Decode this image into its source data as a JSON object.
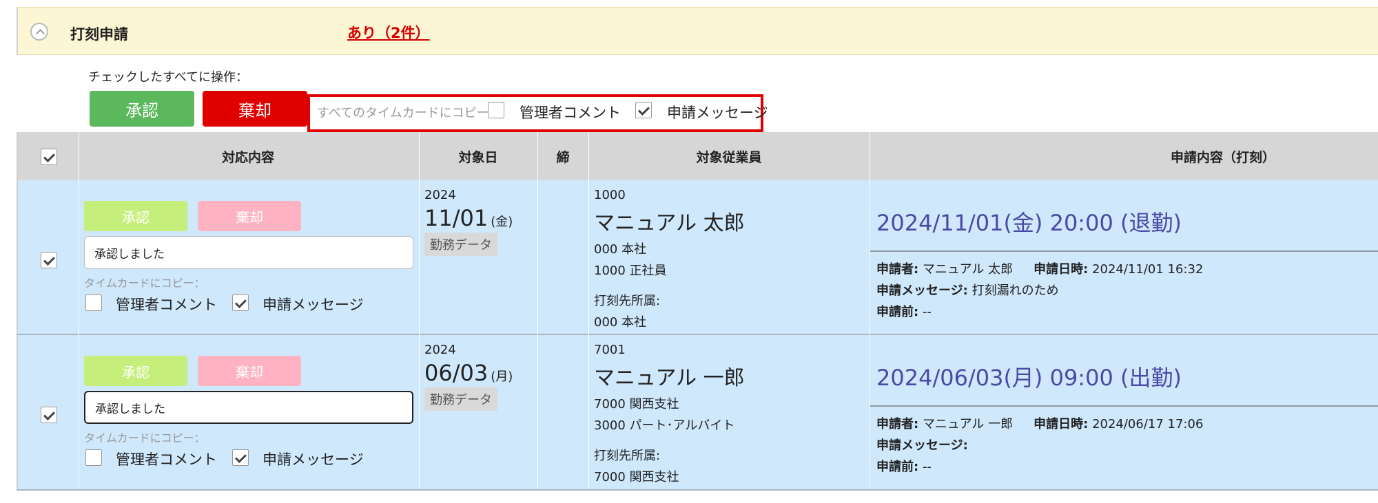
{
  "header": {
    "title": "打刻申請",
    "status_link": "あり（2件）"
  },
  "bulk": {
    "label": "チェックしたすべてに操作：",
    "approve_label": "承認",
    "reject_label": "棄却",
    "copy_label": "すべてのタイムカードにコピー：",
    "manager_comment_label": "管理者コメント",
    "manager_comment_checked": false,
    "request_message_label": "申請メッセージ",
    "request_message_checked": true
  },
  "table": {
    "headers": {
      "action": "対応内容",
      "target_date": "対象日",
      "closing": "締",
      "employee": "対象従業員",
      "request": "申請内容（打刻）"
    },
    "rows": [
      {
        "checked": true,
        "approve_label": "承認",
        "reject_label": "棄却",
        "comment": "承認しました",
        "timecard_copy_label": "タイムカードにコピー：",
        "manager_comment_label": "管理者コメント",
        "request_message_label": "申請メッセージ",
        "year": "2024",
        "date": "11/01",
        "dow": "(金)",
        "badge": "勤務データ",
        "emp_code": "1000",
        "emp_name": "マニュアル 太郎",
        "dept": "000 本社",
        "employment": "1000 正社員",
        "punch_dept_label": "打刻先所属:",
        "punch_dept": "000  本社",
        "request_main": "2024/11/01(金) 20:00 (退勤)",
        "applicant_label": "申請者:",
        "applicant": "マニュアル 太郎",
        "applied_at_label": "申請日時:",
        "applied_at": "2024/11/01 16:32",
        "message_label": "申請メッセージ:",
        "message": "打刻漏れのため",
        "before_label": "申請前:",
        "before": "--"
      },
      {
        "checked": true,
        "approve_label": "承認",
        "reject_label": "棄却",
        "comment": "承認しました",
        "timecard_copy_label": "タイムカードにコピー：",
        "manager_comment_label": "管理者コメント",
        "request_message_label": "申請メッセージ",
        "year": "2024",
        "date": "06/03",
        "dow": "(月)",
        "badge": "勤務データ",
        "emp_code": "7001",
        "emp_name": "マニュアル 一郎",
        "dept": "7000 関西支社",
        "employment": "3000 パート･アルバイト",
        "punch_dept_label": "打刻先所属:",
        "punch_dept": "7000  関西支社",
        "request_main": "2024/06/03(月) 09:00 (出勤)",
        "applicant_label": "申請者:",
        "applicant": "マニュアル 一郎",
        "applied_at_label": "申請日時:",
        "applied_at": "2024/06/17 17:06",
        "message_label": "申請メッセージ:",
        "message": "",
        "before_label": "申請前:",
        "before": "--"
      }
    ]
  }
}
